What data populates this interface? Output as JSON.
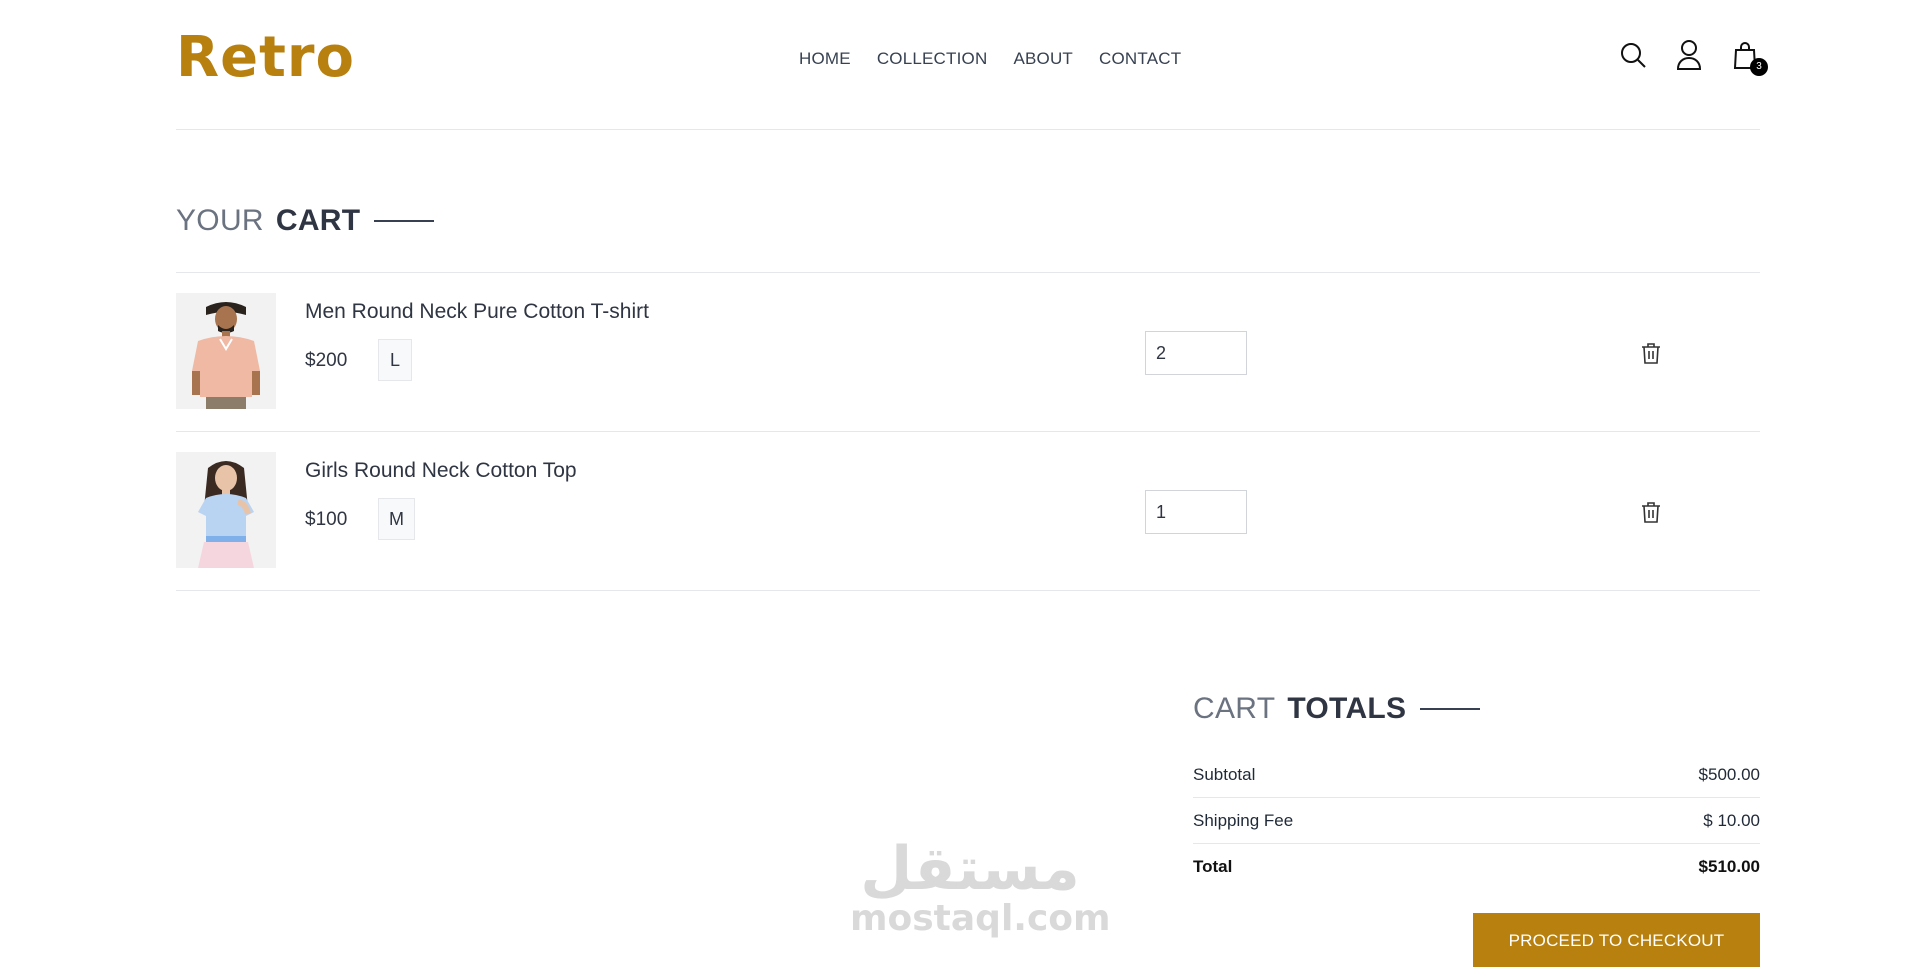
{
  "brand": {
    "logo": "Retro",
    "accent": "#b7800f"
  },
  "nav": {
    "items": [
      "HOME",
      "COLLECTION",
      "ABOUT",
      "CONTACT"
    ]
  },
  "header_icons": {
    "search": "search-icon",
    "profile": "user-icon",
    "cart": "shopping-bag-icon",
    "cart_count": "3"
  },
  "cart": {
    "title_light": "YOUR",
    "title_bold": "CART",
    "items": [
      {
        "name": "Men Round Neck Pure Cotton T-shirt",
        "price": "$200",
        "size": "L",
        "quantity": "2"
      },
      {
        "name": "Girls Round Neck Cotton Top",
        "price": "$100",
        "size": "M",
        "quantity": "1"
      }
    ]
  },
  "totals": {
    "title_light": "CART",
    "title_bold": "TOTALS",
    "rows": [
      {
        "label": "Subtotal",
        "value": "$500.00"
      },
      {
        "label": "Shipping Fee",
        "value": "$ 10.00"
      },
      {
        "label": "Total",
        "value": "$510.00"
      }
    ],
    "checkout_label": "PROCEED TO CHECKOUT"
  },
  "watermark": {
    "arabic": "مستقل",
    "latin": "mostaql.com"
  }
}
